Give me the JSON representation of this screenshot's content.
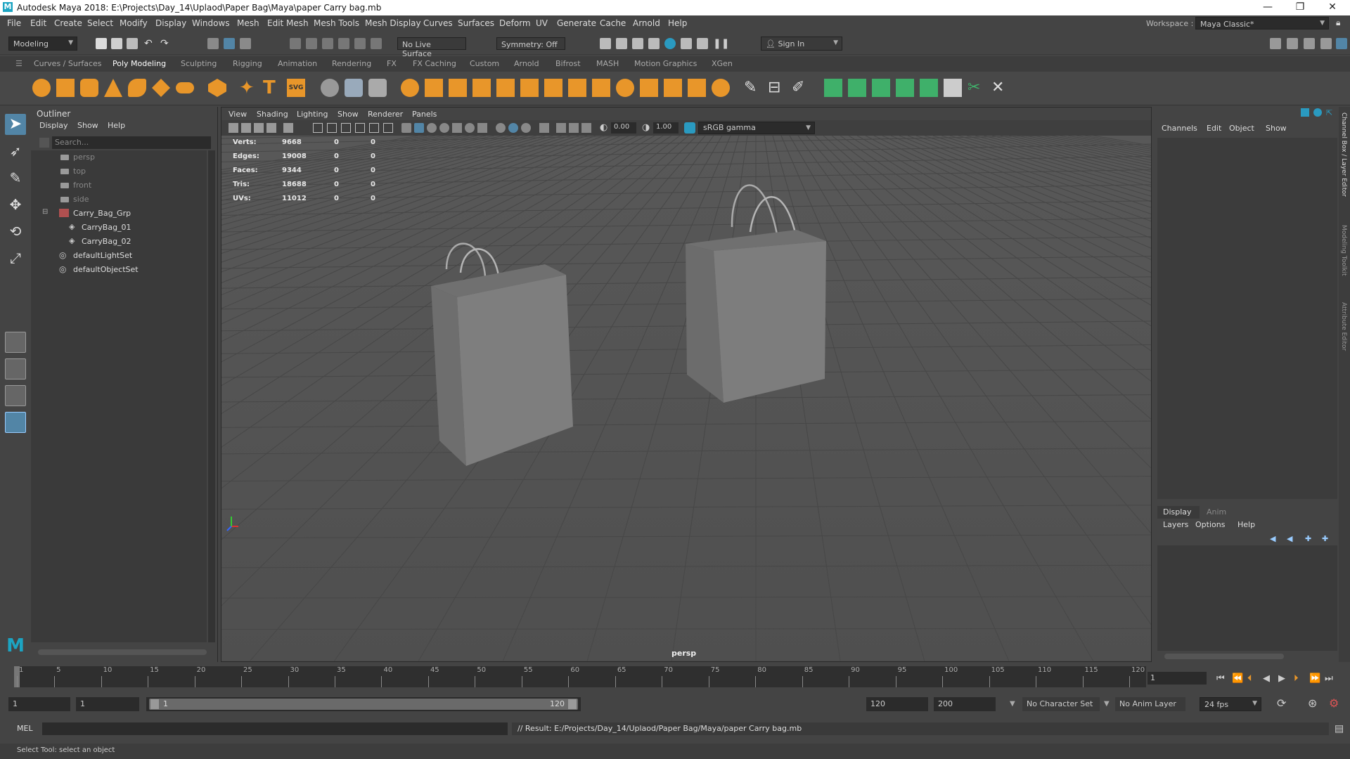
{
  "window": {
    "title": "Autodesk Maya 2018: E:\\Projects\\Day_14\\Uplaod\\Paper Bag\\Maya\\paper Carry bag.mb",
    "logo": "M",
    "minimize": "—",
    "maximize": "❐",
    "close": "✕"
  },
  "menubar": [
    "File",
    "Edit",
    "Create",
    "Select",
    "Modify",
    "Display",
    "Windows",
    "Mesh",
    "Edit Mesh",
    "Mesh Tools",
    "Mesh Display",
    "Curves",
    "Surfaces",
    "Deform",
    "UV",
    "Generate",
    "Cache",
    "Arnold",
    "Help"
  ],
  "workspace": {
    "label": "Workspace :",
    "value": "Maya Classic*"
  },
  "statusline": {
    "mode": "Modeling",
    "live_surface": "No Live Surface",
    "symmetry": "Symmetry: Off",
    "sign_in": "Sign In"
  },
  "shelf_tabs": [
    "Curves / Surfaces",
    "Poly Modeling",
    "Sculpting",
    "Rigging",
    "Animation",
    "Rendering",
    "FX",
    "FX Caching",
    "Custom",
    "Arnold",
    "Bifrost",
    "MASH",
    "Motion Graphics",
    "XGen"
  ],
  "shelf_active": "Poly Modeling",
  "outliner": {
    "title": "Outliner",
    "menu": [
      "Display",
      "Show",
      "Help"
    ],
    "search_placeholder": "Search...",
    "items": [
      {
        "label": "persp",
        "kind": "camera"
      },
      {
        "label": "top",
        "kind": "camera"
      },
      {
        "label": "front",
        "kind": "camera"
      },
      {
        "label": "side",
        "kind": "camera"
      },
      {
        "label": "Carry_Bag_Grp",
        "kind": "group"
      },
      {
        "label": "CarryBag_01",
        "kind": "mesh"
      },
      {
        "label": "CarryBag_02",
        "kind": "mesh"
      },
      {
        "label": "defaultLightSet",
        "kind": "set"
      },
      {
        "label": "defaultObjectSet",
        "kind": "set"
      }
    ]
  },
  "viewport": {
    "menu": [
      "View",
      "Shading",
      "Lighting",
      "Show",
      "Renderer",
      "Panels"
    ],
    "exposure": "0.00",
    "gamma": "1.00",
    "color_space": "sRGB gamma",
    "camera": "persp",
    "hud": [
      {
        "label": "Verts:",
        "a": "9668",
        "b": "0",
        "c": "0"
      },
      {
        "label": "Edges:",
        "a": "19008",
        "b": "0",
        "c": "0"
      },
      {
        "label": "Faces:",
        "a": "9344",
        "b": "0",
        "c": "0"
      },
      {
        "label": "Tris:",
        "a": "18688",
        "b": "0",
        "c": "0"
      },
      {
        "label": "UVs:",
        "a": "11012",
        "b": "0",
        "c": "0"
      }
    ]
  },
  "channelbox": {
    "menu": [
      "Channels",
      "Edit",
      "Object",
      "Show"
    ],
    "layer_tabs": [
      "Display",
      "Anim"
    ],
    "layer_menu": [
      "Layers",
      "Options",
      "Help"
    ]
  },
  "side_tabs": [
    "Channel Box / Layer Editor",
    "Modeling Toolkit",
    "Attribute Editor"
  ],
  "timeline": {
    "ticks": [
      "1",
      "5",
      "10",
      "15",
      "20",
      "25",
      "30",
      "35",
      "40",
      "45",
      "50",
      "55",
      "60",
      "65",
      "70",
      "75",
      "80",
      "85",
      "90",
      "95",
      "100",
      "105",
      "110",
      "115",
      "120"
    ],
    "current_frame": "1"
  },
  "range": {
    "start": "1",
    "playback_start": "1",
    "slider_start": "1",
    "slider_end": "120",
    "playback_end": "120",
    "end": "200",
    "character_set": "No Character Set",
    "anim_layer": "No Anim Layer",
    "fps": "24 fps"
  },
  "cmdline": {
    "lang": "MEL",
    "result": "// Result: E:/Projects/Day_14/Uplaod/Paper Bag/Maya/paper Carry bag.mb"
  },
  "helpline": "Select Tool: select an object",
  "colors": {
    "accent": "#1ca4c2",
    "shelf_orange": "#e8962a",
    "shelf_green": "#3fb06a",
    "selection": "#5285a6"
  }
}
